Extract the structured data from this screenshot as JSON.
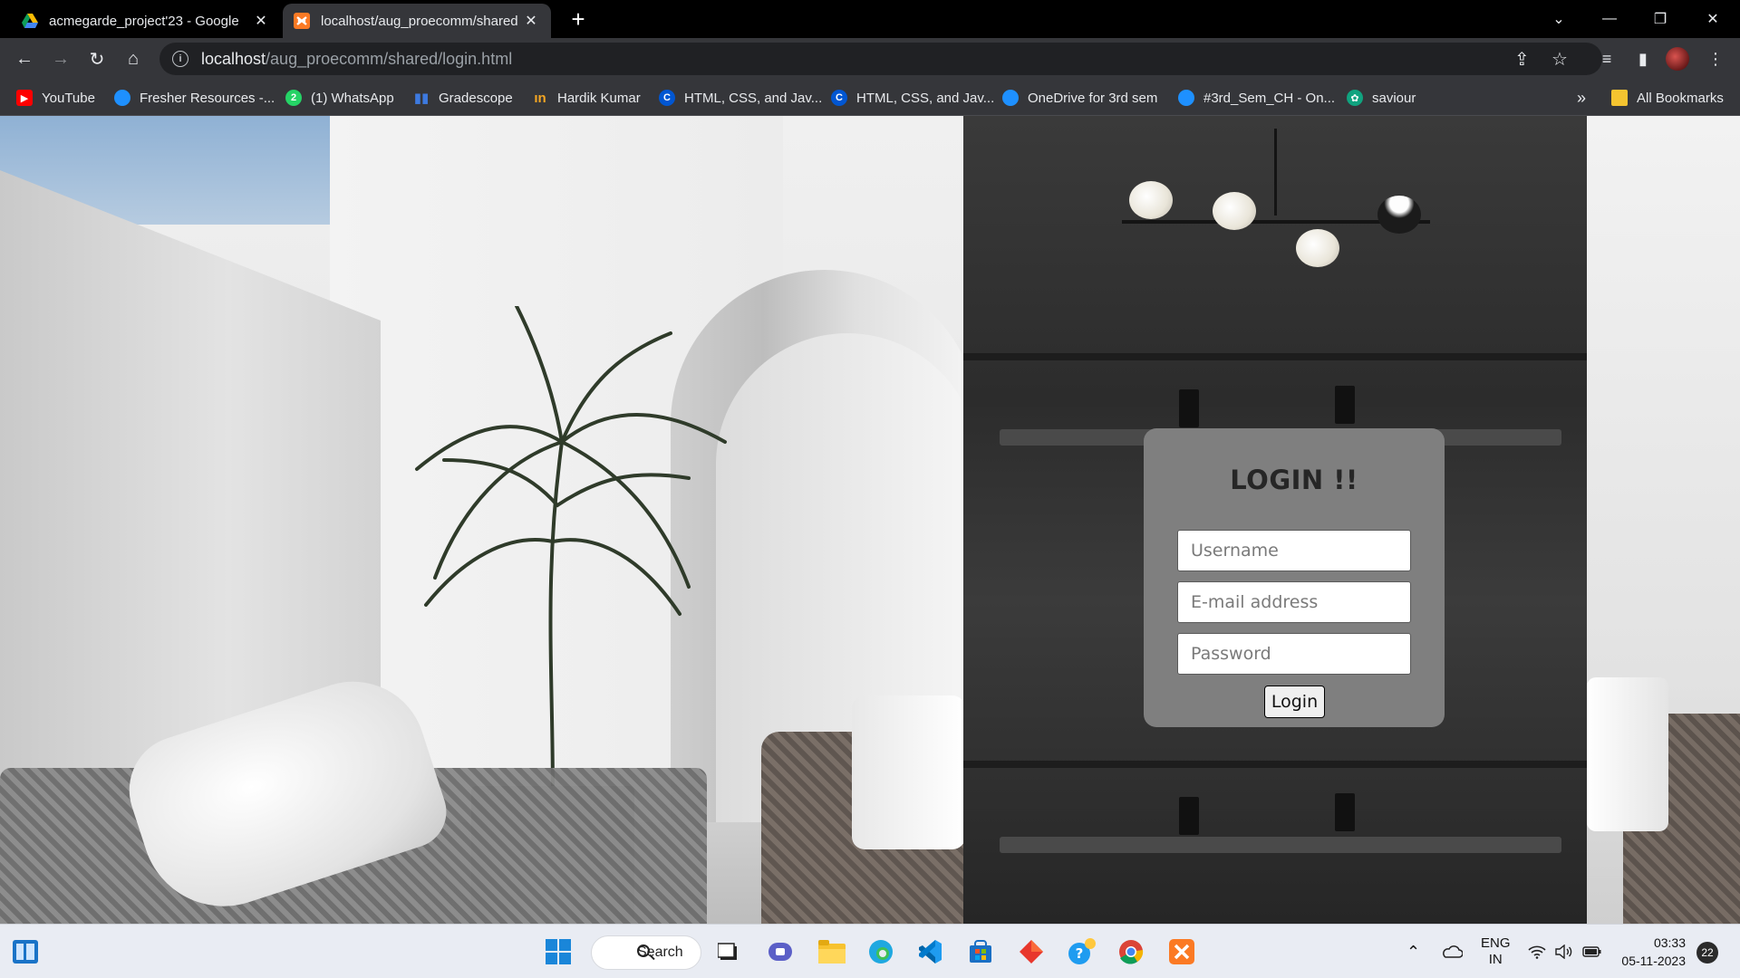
{
  "browser": {
    "tabs": [
      {
        "title": "acmegarde_project'23 - Google",
        "active": false,
        "favicon": "google-drive-icon"
      },
      {
        "title": "localhost/aug_proecomm/shared",
        "active": true,
        "favicon": "xampp-icon"
      }
    ],
    "address": {
      "host": "localhost",
      "path": "/aug_proecomm/shared/login.html"
    },
    "bookmarks": [
      {
        "label": "YouTube",
        "icon": "youtube-icon",
        "color": "#ff0000"
      },
      {
        "label": "Fresher Resources -...",
        "icon": "onedrive-icon",
        "color": "#1e90ff"
      },
      {
        "label": "(1) WhatsApp",
        "icon": "whatsapp-icon",
        "color": "#25d366"
      },
      {
        "label": "Gradescope",
        "icon": "gradescope-icon",
        "color": "#3d7ae0"
      },
      {
        "label": "Hardik Kumar",
        "icon": "medium-icon",
        "color": "#f5a623"
      },
      {
        "label": "HTML, CSS, and Jav...",
        "icon": "coursera-icon",
        "color": "#0056d2"
      },
      {
        "label": "HTML, CSS, and Jav...",
        "icon": "coursera-icon",
        "color": "#0056d2"
      },
      {
        "label": "OneDrive for 3rd sem",
        "icon": "onedrive-icon",
        "color": "#1e90ff"
      },
      {
        "label": "#3rd_Sem_CH - On...",
        "icon": "onedrive-icon",
        "color": "#1e90ff"
      },
      {
        "label": "saviour",
        "icon": "chatgpt-icon",
        "color": "#10a37f"
      }
    ],
    "overflow_label": "»",
    "all_bookmarks_label": "All Bookmarks"
  },
  "login": {
    "title": "LOGIN !!",
    "username_placeholder": "Username",
    "email_placeholder": "E-mail address",
    "password_placeholder": "Password",
    "button_label": "Login"
  },
  "taskbar": {
    "search_label": "Search",
    "language_top": "ENG",
    "language_bottom": "IN",
    "time": "03:33",
    "date": "05-11-2023",
    "notification_count": "22"
  }
}
